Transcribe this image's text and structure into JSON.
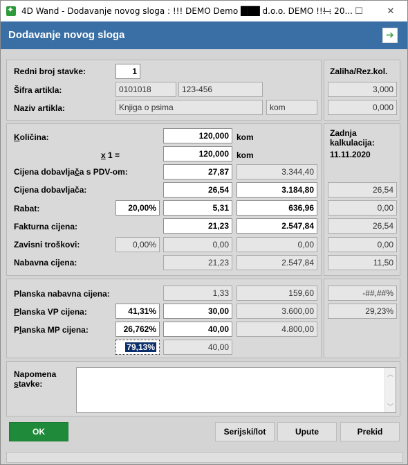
{
  "window": {
    "title": "4D Wand - Dodavanje novog sloga : !!! DEMO Demo ███ d.o.o. DEMO !!! : 20...",
    "minimize": "—",
    "maximize": "☐",
    "close": "✕"
  },
  "header": {
    "title": "Dodavanje novog sloga"
  },
  "top": {
    "redni_label": "Redni broj stavke:",
    "redni_value": "1",
    "sifra_label": "Šifra artikla:",
    "sifra_value1": "0101018",
    "sifra_value2": "123-456",
    "naziv_label": "Naziv artikla:",
    "naziv_value": "Knjiga o psima",
    "naziv_unit": "kom",
    "zaliha_label": "Zaliha/Rez.kol.",
    "zaliha_value": "3,000",
    "rez_value": "0,000"
  },
  "middle": {
    "kolicina_label": "Količina:",
    "kolicina_value": "120,000",
    "kolicina_unit": "kom",
    "x1_label": "x 1 =",
    "x1_value": "120,000",
    "x1_unit": "kom",
    "cdpdv_label": "Cijena dobavljača s PDV-om:",
    "cdpdv_value": "27,87",
    "cdpdv_total": "3.344,40",
    "cd_label": "Cijena dobavljača:",
    "cd_value": "26,54",
    "cd_total": "3.184,80",
    "cd_zadnja": "26,54",
    "rabat_label": "Rabat:",
    "rabat_pct": "20,00%",
    "rabat_value": "5,31",
    "rabat_total": "636,96",
    "rabat_zadnja": "0,00",
    "fakt_label": "Fakturna cijena:",
    "fakt_value": "21,23",
    "fakt_total": "2.547,84",
    "fakt_zadnja": "26,54",
    "zavisni_label": "Zavisni troškovi:",
    "zavisni_pct": "0,00%",
    "zavisni_value": "0,00",
    "zavisni_total": "0,00",
    "zavisni_zadnja": "0,00",
    "nabavna_label": "Nabavna cijena:",
    "nabavna_value": "21,23",
    "nabavna_total": "2.547,84",
    "nabavna_zadnja": "11,50",
    "zadnja_label1": "Zadnja",
    "zadnja_label2": "kalkulacija:",
    "zadnja_date": "11.11.2020"
  },
  "bottom": {
    "pnc_label": "Planska nabavna cijena:",
    "pnc_value": "1,33",
    "pnc_total": "159,60",
    "pnc_side": "-##,##%",
    "pvp_label": "Planska VP cijena:",
    "pvp_pct": "41,31%",
    "pvp_value": "30,00",
    "pvp_total": "3.600,00",
    "pvp_side": "29,23%",
    "pmp_label": "Planska MP cijena:",
    "pmp_pct": "26,762%",
    "pmp_value": "40,00",
    "pmp_total": "4.800,00",
    "extra_pct": "79,13%",
    "extra_value": "40,00"
  },
  "note": {
    "label1": "Napomena",
    "label2": "stavke:",
    "value": ""
  },
  "buttons": {
    "ok": "OK",
    "serijski": "Serijski/lot",
    "upute": "Upute",
    "prekid": "Prekid"
  }
}
